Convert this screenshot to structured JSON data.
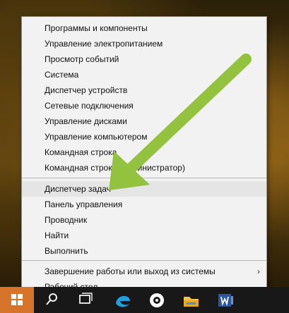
{
  "menu": {
    "items": [
      {
        "label": "Программы и компоненты",
        "has_submenu": false
      },
      {
        "label": "Управление электропитанием",
        "has_submenu": false
      },
      {
        "label": "Просмотр событий",
        "has_submenu": false
      },
      {
        "label": "Система",
        "has_submenu": false
      },
      {
        "label": "Диспетчер устройств",
        "has_submenu": false
      },
      {
        "label": "Сетевые подключения",
        "has_submenu": false
      },
      {
        "label": "Управление дисками",
        "has_submenu": false
      },
      {
        "label": "Управление компьютером",
        "has_submenu": false
      },
      {
        "label": "Командная строка",
        "has_submenu": false
      },
      {
        "label": "Командная строка (администратор)",
        "has_submenu": false
      },
      {
        "label": "Диспетчер задач",
        "has_submenu": false,
        "highlighted": true
      },
      {
        "label": "Панель управления",
        "has_submenu": false
      },
      {
        "label": "Проводник",
        "has_submenu": false
      },
      {
        "label": "Найти",
        "has_submenu": false
      },
      {
        "label": "Выполнить",
        "has_submenu": false
      },
      {
        "label": "Завершение работы или выход из системы",
        "has_submenu": true
      },
      {
        "label": "Рабочий стол",
        "has_submenu": false
      }
    ]
  },
  "colors": {
    "menu_background": "#f2f2f2",
    "highlight": "#e5e5e5",
    "arrow": "#93c23f",
    "start": "#d7742b",
    "taskbar": "#181818"
  },
  "taskbar": {
    "icons": [
      "windows-logo-icon",
      "search-icon",
      "task-view-icon",
      "edge-icon",
      "media-player-icon",
      "file-explorer-icon",
      "word-icon"
    ]
  }
}
